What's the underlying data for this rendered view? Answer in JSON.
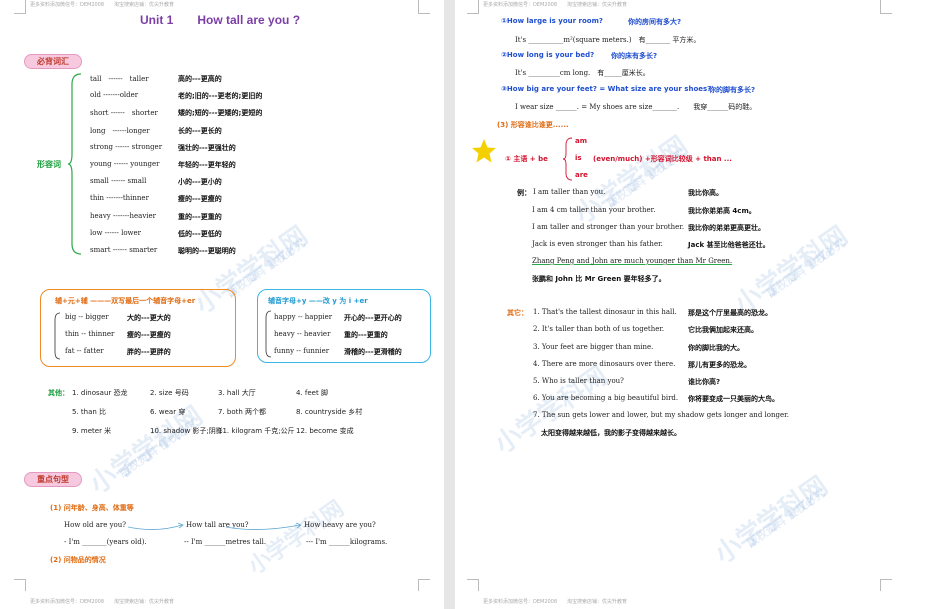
{
  "page1": {
    "header": "更多资料添加微信号：DEM2008　　淘宝搜索店铺：优尖升教育",
    "footer": "更多资料添加微信号：DEM2008　　淘宝搜索店铺：优尖升教育",
    "title": "Unit 1　　How tall are you ?",
    "section_vocab": "必背词汇",
    "adj_label": "形容词",
    "adjectives": [
      {
        "word": "tall　------　taller",
        "cn": "高的---更高的"
      },
      {
        "word": "old -------older",
        "cn": "老的;旧的---更老的;更旧的"
      },
      {
        "word": "short ------　shorter",
        "cn": "矮的;短的---更矮的;更短的"
      },
      {
        "word": "long　------longer",
        "cn": "长的---更长的"
      },
      {
        "word": "strong ------ stronger",
        "cn": "强壮的---更强壮的"
      },
      {
        "word": "young ------ younger",
        "cn": "年轻的---更年轻的"
      },
      {
        "word": "small ------ small",
        "cn": "小的---更小的"
      },
      {
        "word": "thin -------thinner",
        "cn": "瘦的---更瘦的"
      },
      {
        "word": "heavy -------heavier",
        "cn": "重的---更重的"
      },
      {
        "word": "low ------ lower",
        "cn": "低的---更低的"
      },
      {
        "word": "smart ------ smarter",
        "cn": "聪明的---更聪明的"
      }
    ],
    "rule_box1": {
      "title": "辅+元+辅 ———双写最后一个辅音字母+er",
      "items": [
        {
          "word": "big -- bigger",
          "cn": "大的---更大的"
        },
        {
          "word": "thin -- thinner",
          "cn": "瘦的---更瘦的"
        },
        {
          "word": "fat -- fatter",
          "cn": "胖的---更胖的"
        }
      ]
    },
    "rule_box2": {
      "title": "辅音字母+y ——改 y 为 i +er",
      "items": [
        {
          "word": "happy -- happier",
          "cn": "开心的---更开心的"
        },
        {
          "word": "heavy -- heavier",
          "cn": "重的---更重的"
        },
        {
          "word": "funny -- funnier",
          "cn": "滑稽的---更滑稽的"
        }
      ]
    },
    "others_label": "其他：",
    "others": [
      [
        "1. dinosaur 恐龙",
        "2. size 号码",
        "3. hall 大厅",
        "4. feet 脚"
      ],
      [
        "5. than 比",
        "6. wear 穿",
        "7. both 两个都",
        "8. countryside 乡村"
      ],
      [
        "9. meter 米",
        "10. shadow 影子;阴影",
        "11. kilogram 千克;公斤",
        "12. become 变成"
      ]
    ],
    "section_sentences": "重点句型",
    "sub1": "(1)  问年龄、身高、体重等",
    "q1": "How old are you?",
    "q2": "How tall are you?",
    "q3": "How heavy are you?",
    "a1": "- I'm _______(years old).",
    "a2": "-- I'm ______metres tall.",
    "a3": "--- I'm ______kilograms.",
    "sub2": "(2)  问物品的情况"
  },
  "page2": {
    "header": "更多资料添加微信号：DEM2008　　淘宝搜索店铺：优尖升教育",
    "footer": "更多资料添加微信号：DEM2008　　淘宝搜索店铺：优尖升教育",
    "q1": {
      "en": "①How large is your room?",
      "cn": "你的房间有多大?",
      "ans": "It's __________m²(square meters.)　有_______ 平方米。"
    },
    "q2": {
      "en": "②How long is your bed?",
      "cn": "你的床有多长?",
      "ans": "It's _________cm long.　有_____厘米长。"
    },
    "q3": {
      "en": "③How big are your feet? = What size are your shoes?",
      "cn": "你的脚有多长?",
      "ans": "I wear size ______. = My shoes are size_______.　　我穿______码的鞋。"
    },
    "sub3": "(3)  形容谁比谁更......",
    "formula_prefix": "①  主语 + be",
    "formula_verbs": [
      "am",
      "is",
      "are"
    ],
    "formula_rest": "(even/much) +形容词比较级 + than ...",
    "example_label": "例：",
    "examples": [
      {
        "en": "I am taller than you.",
        "cn": "我比你高。"
      },
      {
        "en": "I am 4 cm taller than your brother.",
        "cn": "我比你弟弟高 4cm。"
      },
      {
        "en": "I am taller and stronger than your brother.",
        "cn": "我比你的弟弟更高更壮。"
      },
      {
        "en": "Jack is even stronger than his father.",
        "cn": "Jack 甚至比他爸爸还壮。"
      },
      {
        "en": "Zhang Peng and John are much younger than Mr Green.",
        "cn": ""
      },
      {
        "en": "",
        "cn": "张鹏和 John 比 Mr Green 要年轻多了。"
      }
    ],
    "others_label": "其它：",
    "others": [
      {
        "en": "1. That's the tallest dinosaur in this hall.",
        "cn": "那是这个厅里最高的恐龙。"
      },
      {
        "en": "2. It's taller than both of us together.",
        "cn": "它比我俩加起来还高。"
      },
      {
        "en": "3. Your feet are bigger than mine.",
        "cn": "你的脚比我的大。"
      },
      {
        "en": "4. There are more dinosaurs over there.",
        "cn": "那儿有更多的恐龙。"
      },
      {
        "en": "5. Who is taller than you?",
        "cn": "谁比你高?"
      },
      {
        "en": "6. You are becoming a big beautiful bird.",
        "cn": "你将要变成一只美丽的大鸟。"
      },
      {
        "en": "7. The sun gets lower and lower, but my shadow gets longer and longer.",
        "cn": ""
      },
      {
        "en": "",
        "cn": "太阳变得越来越低，我的影子变得越来越长。"
      }
    ]
  },
  "watermark": {
    "text1": "小学学科网",
    "text2": "版权资料 侵权必究",
    "url": "www.zxxk.com"
  },
  "colors": {
    "purple": "#7b3fa7",
    "orange": "#e06b12",
    "blue": "#1f4fd0",
    "red": "#d2122e",
    "green": "#1e9e3e",
    "box_orange": "#f08a24",
    "box_cyan": "#3cb6e3",
    "pill_pink": "#f6c9de",
    "star": "#f5d000"
  }
}
